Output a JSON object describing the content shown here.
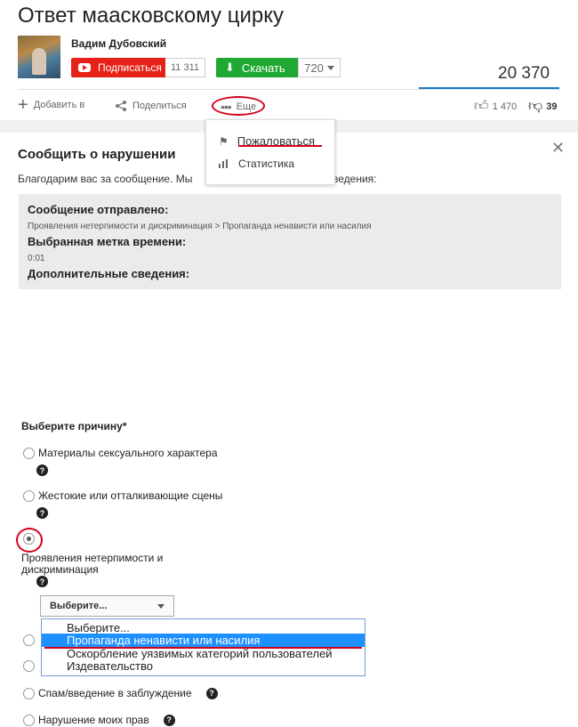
{
  "video": {
    "title": "Ответ маасковскому цирку",
    "author": "Вадим Дубовский",
    "subscribe_label": "Подписаться",
    "subscriber_count": "11 311",
    "download_label": "Скачать",
    "quality": "720",
    "views": "20 370"
  },
  "actions": {
    "add_label": "Добавить в",
    "share_label": "Поделиться",
    "more_label": "Еще",
    "likes": "1 470",
    "dislikes": "39"
  },
  "more_menu": {
    "items": [
      {
        "label": "Пожаловаться",
        "icon": "flag-icon"
      },
      {
        "label": "Статистика",
        "icon": "stats-icon"
      }
    ]
  },
  "report_panel": {
    "title": "Сообщить о нарушении",
    "thanks_text": "Благодарим вас за сообщение. Мы",
    "thanks_text_end": "сведения:",
    "sent_heading": "Сообщение отправлено:",
    "sent_value": "Проявления нетерпимости и дискриминация > Пропаганда ненависти или насилия",
    "timestamp_heading": "Выбранная метка времени:",
    "timestamp_value": "0:01",
    "extra_heading": "Дополнительные сведения:"
  },
  "reason_form": {
    "title": "Выберите причину*",
    "options": [
      {
        "label": "Материалы сексуального характера"
      },
      {
        "label": "Жестокие или отталкивающие сцены"
      },
      {
        "label_line1": "Проявления нетерпимости и",
        "label_line2": "дискриминация"
      },
      {
        "label": "Спам/введение в заблуждение"
      },
      {
        "label": "Нарушение моих прав"
      }
    ],
    "select_value": "Выберите...",
    "dropdown_options": [
      "Выберите...",
      "Пропаганда ненависти или насилия",
      "Оскорбление уязвимых категорий пользователей",
      "Издевательство"
    ]
  },
  "colors": {
    "subscribe_red": "#e62117",
    "download_green": "#1fa832",
    "highlight_blue": "#1e90ff",
    "annotation_red": "#d0021b"
  }
}
